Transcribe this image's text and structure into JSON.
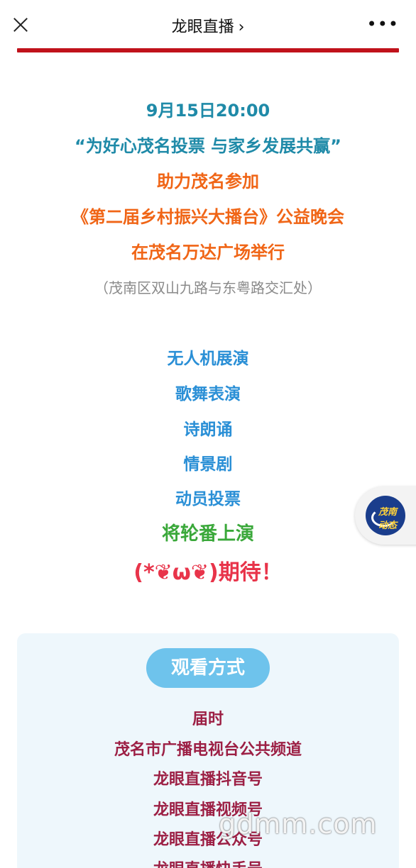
{
  "header": {
    "title": "龙眼直播",
    "chevron": "›"
  },
  "event": {
    "date": "9月15日20:00",
    "slogan": "“为好心茂名投票 与家乡发展共赢”",
    "line1": "助力茂名参加",
    "line2": "《第二届乡村振兴大播台》公益晚会",
    "line3": "在茂名万达广场举行",
    "address": "（茂南区双山九路与东粤路交汇处）"
  },
  "program": [
    "无人机展演",
    "歌舞表演",
    "诗朗诵",
    "情景剧",
    "动员投票"
  ],
  "closing": "将轮番上演",
  "excited": "(*❦ω❦)期待！",
  "float_button": {
    "icon": "maonan-dongtai-logo-icon",
    "label": "茂南动态"
  },
  "watch": {
    "title": "观看方式",
    "lines": [
      "届时",
      "茂名市广播电视台公共频道",
      "龙眼直播抖音号",
      "龙眼直播视频号",
      "龙眼直播公众号",
      "龙眼直播快手号"
    ]
  },
  "watermark": "gdmm.com",
  "colors": {
    "accent_red": "#c0121b",
    "teal": "#1f8aa8",
    "orange": "#f06516",
    "blue": "#2a8fd6",
    "green": "#3aa83a",
    "pink": "#e8344a",
    "maroon": "#9c1f44",
    "pill": "#6ec3ec"
  }
}
